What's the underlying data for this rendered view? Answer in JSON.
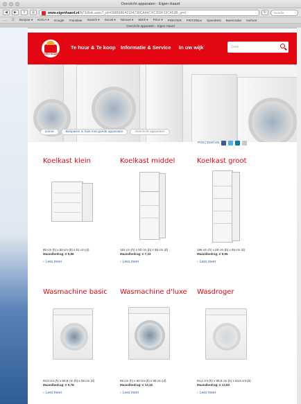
{
  "browser": {
    "window_title": "Overzicht apparaten - Eigen Haard",
    "url_domain": "www.eigenhaard.nl",
    "url_rest": "/NTE/link.aspx?_id=698B98E42194738CA44C4C359F33C453B_g=d",
    "search_placeholder": "Reader",
    "tab_title": "Overzicht apparaten - Eigen Haard",
    "bookmarks": [
      "Bonjour ▾",
      "KOCA ▾",
      "Google",
      "Translate",
      "Search ▾",
      "Social ▾",
      "Nieuws ▾",
      "Werk ▾",
      "Price ▾",
      "PRINTER",
      "FRITZ!Box",
      "Speedtest",
      "Buienradar",
      "Isohunt"
    ]
  },
  "site": {
    "logo_text": "EIGEN HAARD",
    "nav": [
      "Te huur & Te koop",
      "Informatie & Service",
      "In uw wijk"
    ],
    "search_placeholder": "Zoek"
  },
  "breadcrumb": [
    "Home",
    "Besparen in huis met goede apparaten",
    "Overzicht apparaten"
  ],
  "share": {
    "label": "Print | Deel via"
  },
  "products": [
    {
      "title": "Koelkast klein",
      "dims": "85 cm (h) x 60 cm (b) x 61 cm (d)",
      "amount": "Maandbedrag: € 5,86",
      "more": "Lees meer"
    },
    {
      "title": "Koelkast middel",
      "dims": "161 cm (h) x 60 cm (b) x 65 cm (d)",
      "amount": "Maandbedrag: € 7,33",
      "more": "Lees meer"
    },
    {
      "title": "Koelkast groot",
      "dims": "186 cm (h) x 60 cm (b) x 65 cm (d)",
      "amount": "Maandbedrag: € 9,95",
      "more": "Lees meer"
    },
    {
      "title": "Wasmachine basic",
      "dims": "84,8 cm (h) x 59,8 cm (b) x 55 cm (d)",
      "amount": "Maandbedrag: € 9,78",
      "more": "Lees meer"
    },
    {
      "title": "Wasmachine d'luxe",
      "dims": "85 cm (h) x 60 cm (b) x 59 cm (d)",
      "amount": "Maandbedrag: € 13,15",
      "more": "Lees meer"
    },
    {
      "title": "Wasdroger",
      "dims": "84,2 cm (h) x 59,8 cm (b) x 63,9 cm (d)",
      "amount": "Maandbedrag: € 12,83",
      "more": "Lees meer"
    }
  ],
  "colors": {
    "brand_red": "#e30613",
    "link_blue": "#3366aa"
  }
}
